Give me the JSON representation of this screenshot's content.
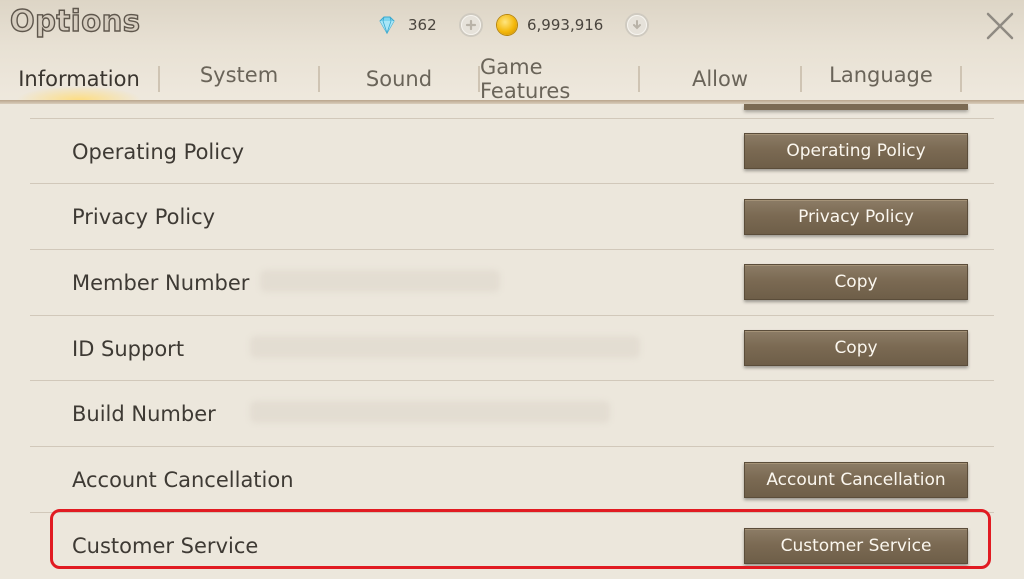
{
  "window": {
    "title": "Options",
    "close_icon": "close-x-icon"
  },
  "currencies": {
    "gems": {
      "icon": "diamond-icon",
      "value": "362",
      "action_icon": "plus-icon"
    },
    "gold": {
      "icon": "gold-coin-icon",
      "value": "6,993,916",
      "action_icon": "download-arrow-icon"
    }
  },
  "tabs": [
    {
      "label": "Information",
      "active": true
    },
    {
      "label": "System",
      "active": false
    },
    {
      "label": "Sound",
      "active": false
    },
    {
      "label": "Game Features",
      "active": false
    },
    {
      "label": "Allow",
      "active": false
    },
    {
      "label": "Language",
      "active": false
    }
  ],
  "rows": [
    {
      "label": "Operating Policy",
      "button": "Operating Policy"
    },
    {
      "label": "Privacy Policy",
      "button": "Privacy Policy"
    },
    {
      "label": "Member Number",
      "button": "Copy"
    },
    {
      "label": "ID Support",
      "button": "Copy"
    },
    {
      "label": "Build Number",
      "button": ""
    },
    {
      "label": "Account Cancellation",
      "button": "Account Cancellation"
    },
    {
      "label": "Customer Service",
      "button": "Customer Service",
      "highlighted": true
    }
  ],
  "colors": {
    "background": "#ece7dc",
    "button": "#7b6a53",
    "highlight": "#e11b22",
    "text": "#3e3a34"
  }
}
